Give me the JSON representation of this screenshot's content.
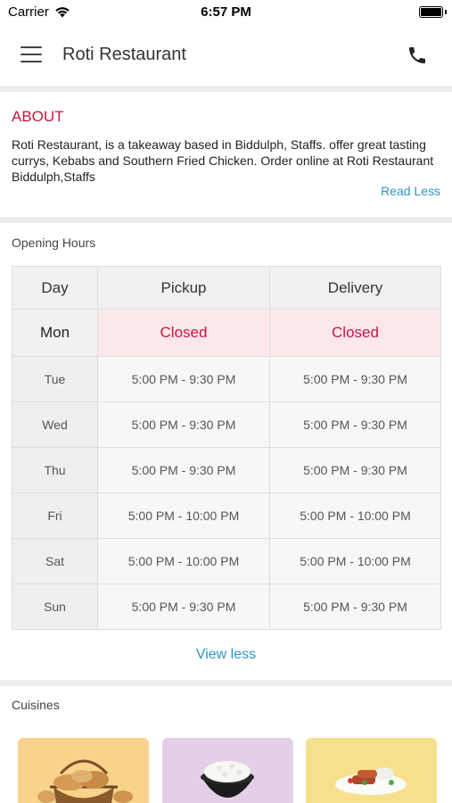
{
  "status_bar": {
    "carrier": "Carrier",
    "time": "6:57 PM"
  },
  "header": {
    "title": "Roti Restaurant"
  },
  "about": {
    "title": "ABOUT",
    "text": "Roti Restaurant, is a takeaway based in Biddulph, Staffs. offer great tasting currys, Kebabs and Southern Fried Chicken. Order online at Roti Restaurant Biddulph,Staffs",
    "read_less": "Read Less"
  },
  "opening_hours": {
    "label": "Opening Hours",
    "columns": [
      "Day",
      "Pickup",
      "Delivery"
    ],
    "rows": [
      {
        "day": "Mon",
        "pickup": "Closed",
        "delivery": "Closed"
      },
      {
        "day": "Tue",
        "pickup": "5:00 PM - 9:30 PM",
        "delivery": "5:00 PM - 9:30 PM"
      },
      {
        "day": "Wed",
        "pickup": "5:00 PM - 9:30 PM",
        "delivery": "5:00 PM - 9:30 PM"
      },
      {
        "day": "Thu",
        "pickup": "5:00 PM - 9:30 PM",
        "delivery": "5:00 PM - 9:30 PM"
      },
      {
        "day": "Fri",
        "pickup": "5:00 PM - 10:00 PM",
        "delivery": "5:00 PM - 10:00 PM"
      },
      {
        "day": "Sat",
        "pickup": "5:00 PM - 10:00 PM",
        "delivery": "5:00 PM - 10:00 PM"
      },
      {
        "day": "Sun",
        "pickup": "5:00 PM - 9:30 PM",
        "delivery": "5:00 PM - 9:30 PM"
      }
    ],
    "view_less": "View less"
  },
  "cuisines": {
    "label": "Cuisines",
    "items": [
      {
        "image": "bread-basket-image",
        "color": "#f7d38c"
      },
      {
        "image": "rice-bowl-image",
        "color": "#e3d0e8"
      },
      {
        "image": "kebab-plate-image",
        "color": "#f6e08c"
      }
    ]
  },
  "colors": {
    "accent_red": "#c8143c",
    "link_blue": "#2a97c9",
    "closed_bg": "#fce8ea"
  }
}
